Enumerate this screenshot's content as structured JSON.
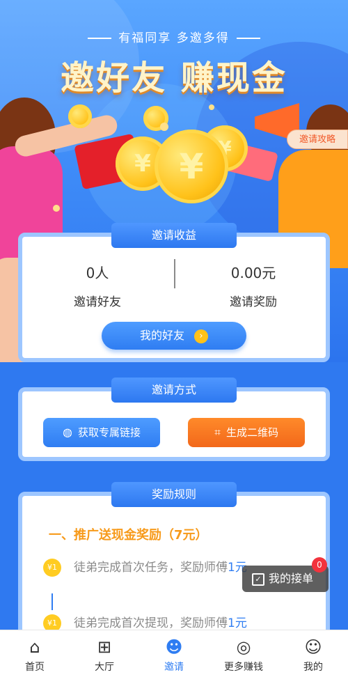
{
  "hero": {
    "subtitle": "有福同享 多邀多得",
    "title": "邀好友 赚现金",
    "strategy_tag": "邀请攻略"
  },
  "earnings": {
    "tab": "邀请收益",
    "friends_count": "0人",
    "friends_label": "邀请好友",
    "reward_amount": "0.00元",
    "reward_label": "邀请奖励",
    "my_friends_button": "我的好友"
  },
  "methods": {
    "tab": "邀请方式",
    "link_button": "获取专属链接",
    "qr_button": "生成二维码"
  },
  "rules": {
    "tab": "奖励规则",
    "heading": "一、推广送现金奖励（7元）",
    "items": [
      {
        "badge": "¥1",
        "text": "徒弟完成首次任务，奖励师傅",
        "amount": "1元"
      },
      {
        "badge": "¥1",
        "text": "徒弟完成首次提现，奖励师傅",
        "amount": "1元"
      }
    ]
  },
  "float_order": {
    "label": "我的接单",
    "count": "0"
  },
  "nav": [
    {
      "label": "首页",
      "icon": "home-icon"
    },
    {
      "label": "大厅",
      "icon": "grid-icon"
    },
    {
      "label": "邀请",
      "icon": "add-user-icon",
      "active": true
    },
    {
      "label": "更多赚钱",
      "icon": "compass-icon"
    },
    {
      "label": "我的",
      "icon": "profile-icon"
    }
  ],
  "colors": {
    "primary": "#2f7df2",
    "orange": "#f2681a",
    "gold": "#f79a1a"
  }
}
